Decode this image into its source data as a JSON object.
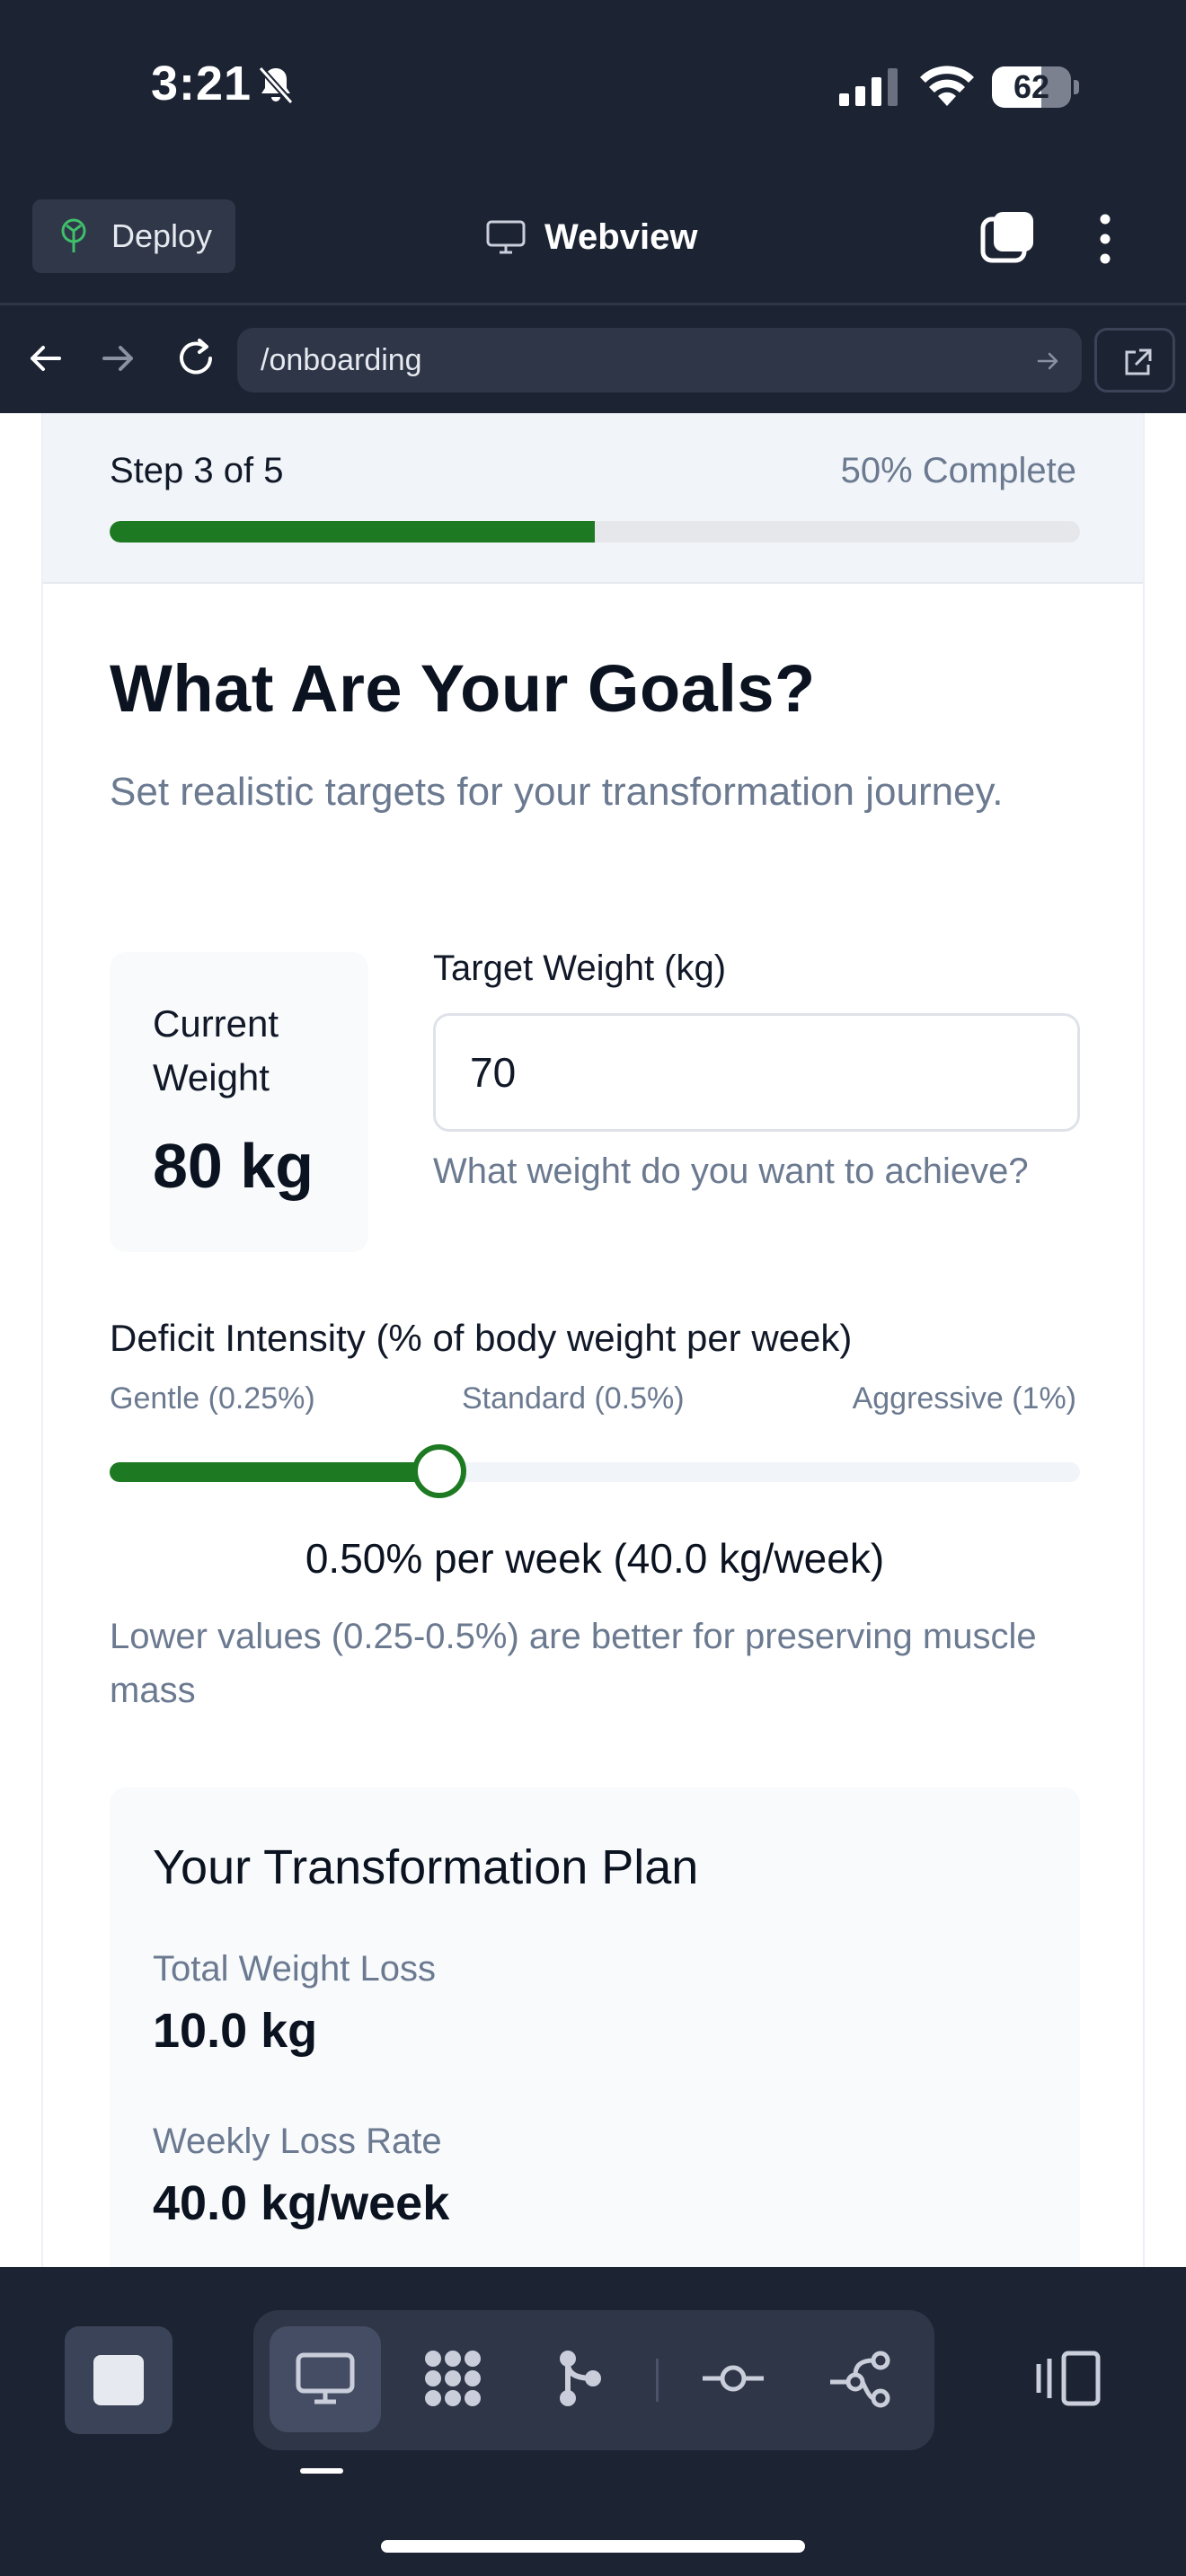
{
  "status_bar": {
    "time": "3:21",
    "battery_level": "62",
    "battery_fraction": 0.62
  },
  "toolbar": {
    "deploy_label": "Deploy",
    "title": "Webview"
  },
  "address_bar": {
    "url": "/onboarding"
  },
  "onboarding": {
    "step_label": "Step 3 of 5",
    "complete_label": "50% Complete",
    "progress_fraction": 0.5,
    "title": "What Are Your Goals?",
    "subtitle": "Set realistic targets for your transformation journey.",
    "current_weight_label": "Current Weight",
    "current_weight_value": "80 kg",
    "target_weight_label": "Target Weight (kg)",
    "target_weight_value": "70",
    "target_weight_help": "What weight do you want to achieve?",
    "deficit_title": "Deficit Intensity (% of body weight per week)",
    "deficit_ticks": {
      "low": "Gentle (0.25%)",
      "mid": "Standard (0.5%)",
      "high": "Aggressive (1%)"
    },
    "deficit_value_percent": 0.5,
    "deficit_slider_fraction": 0.34,
    "rate_readout": "0.50% per week (40.0 kg/week)",
    "rate_note": "Lower values (0.25-0.5%) are better for preserving muscle mass",
    "plan": {
      "title": "Your Transformation Plan",
      "items": [
        {
          "label": "Total Weight Loss",
          "value": "10.0 kg"
        },
        {
          "label": "Weekly Loss Rate",
          "value": "40.0 kg/week"
        }
      ]
    }
  },
  "colors": {
    "accent_green": "#1e7a22",
    "chrome_bg": "#1c2333",
    "muted_text": "#6b7a90"
  },
  "bottom_bar": {
    "tools": [
      "monitor-icon",
      "grid-dots-icon",
      "branch-icon",
      "commit-icon",
      "git-graph-icon"
    ],
    "active_tool": "monitor-icon"
  }
}
